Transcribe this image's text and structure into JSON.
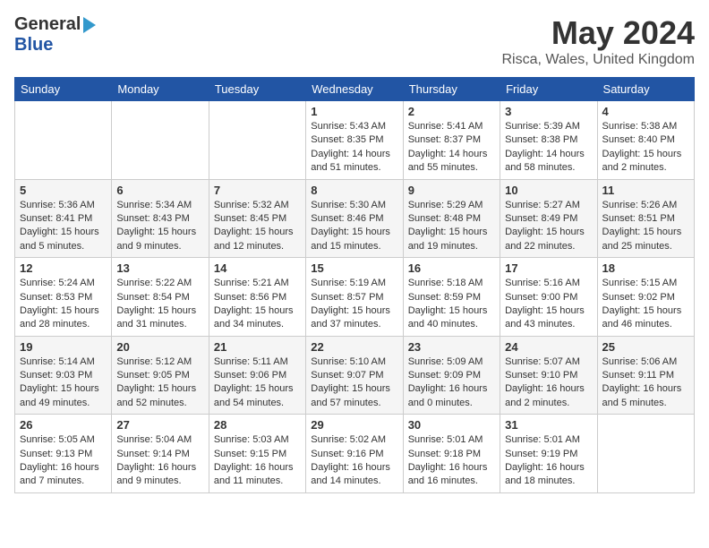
{
  "logo": {
    "general": "General",
    "blue": "Blue"
  },
  "title": {
    "month_year": "May 2024",
    "location": "Risca, Wales, United Kingdom"
  },
  "weekdays": [
    "Sunday",
    "Monday",
    "Tuesday",
    "Wednesday",
    "Thursday",
    "Friday",
    "Saturday"
  ],
  "weeks": [
    [
      {
        "day": "",
        "info": ""
      },
      {
        "day": "",
        "info": ""
      },
      {
        "day": "",
        "info": ""
      },
      {
        "day": "1",
        "info": "Sunrise: 5:43 AM\nSunset: 8:35 PM\nDaylight: 14 hours\nand 51 minutes."
      },
      {
        "day": "2",
        "info": "Sunrise: 5:41 AM\nSunset: 8:37 PM\nDaylight: 14 hours\nand 55 minutes."
      },
      {
        "day": "3",
        "info": "Sunrise: 5:39 AM\nSunset: 8:38 PM\nDaylight: 14 hours\nand 58 minutes."
      },
      {
        "day": "4",
        "info": "Sunrise: 5:38 AM\nSunset: 8:40 PM\nDaylight: 15 hours\nand 2 minutes."
      }
    ],
    [
      {
        "day": "5",
        "info": "Sunrise: 5:36 AM\nSunset: 8:41 PM\nDaylight: 15 hours\nand 5 minutes."
      },
      {
        "day": "6",
        "info": "Sunrise: 5:34 AM\nSunset: 8:43 PM\nDaylight: 15 hours\nand 9 minutes."
      },
      {
        "day": "7",
        "info": "Sunrise: 5:32 AM\nSunset: 8:45 PM\nDaylight: 15 hours\nand 12 minutes."
      },
      {
        "day": "8",
        "info": "Sunrise: 5:30 AM\nSunset: 8:46 PM\nDaylight: 15 hours\nand 15 minutes."
      },
      {
        "day": "9",
        "info": "Sunrise: 5:29 AM\nSunset: 8:48 PM\nDaylight: 15 hours\nand 19 minutes."
      },
      {
        "day": "10",
        "info": "Sunrise: 5:27 AM\nSunset: 8:49 PM\nDaylight: 15 hours\nand 22 minutes."
      },
      {
        "day": "11",
        "info": "Sunrise: 5:26 AM\nSunset: 8:51 PM\nDaylight: 15 hours\nand 25 minutes."
      }
    ],
    [
      {
        "day": "12",
        "info": "Sunrise: 5:24 AM\nSunset: 8:53 PM\nDaylight: 15 hours\nand 28 minutes."
      },
      {
        "day": "13",
        "info": "Sunrise: 5:22 AM\nSunset: 8:54 PM\nDaylight: 15 hours\nand 31 minutes."
      },
      {
        "day": "14",
        "info": "Sunrise: 5:21 AM\nSunset: 8:56 PM\nDaylight: 15 hours\nand 34 minutes."
      },
      {
        "day": "15",
        "info": "Sunrise: 5:19 AM\nSunset: 8:57 PM\nDaylight: 15 hours\nand 37 minutes."
      },
      {
        "day": "16",
        "info": "Sunrise: 5:18 AM\nSunset: 8:59 PM\nDaylight: 15 hours\nand 40 minutes."
      },
      {
        "day": "17",
        "info": "Sunrise: 5:16 AM\nSunset: 9:00 PM\nDaylight: 15 hours\nand 43 minutes."
      },
      {
        "day": "18",
        "info": "Sunrise: 5:15 AM\nSunset: 9:02 PM\nDaylight: 15 hours\nand 46 minutes."
      }
    ],
    [
      {
        "day": "19",
        "info": "Sunrise: 5:14 AM\nSunset: 9:03 PM\nDaylight: 15 hours\nand 49 minutes."
      },
      {
        "day": "20",
        "info": "Sunrise: 5:12 AM\nSunset: 9:05 PM\nDaylight: 15 hours\nand 52 minutes."
      },
      {
        "day": "21",
        "info": "Sunrise: 5:11 AM\nSunset: 9:06 PM\nDaylight: 15 hours\nand 54 minutes."
      },
      {
        "day": "22",
        "info": "Sunrise: 5:10 AM\nSunset: 9:07 PM\nDaylight: 15 hours\nand 57 minutes."
      },
      {
        "day": "23",
        "info": "Sunrise: 5:09 AM\nSunset: 9:09 PM\nDaylight: 16 hours\nand 0 minutes."
      },
      {
        "day": "24",
        "info": "Sunrise: 5:07 AM\nSunset: 9:10 PM\nDaylight: 16 hours\nand 2 minutes."
      },
      {
        "day": "25",
        "info": "Sunrise: 5:06 AM\nSunset: 9:11 PM\nDaylight: 16 hours\nand 5 minutes."
      }
    ],
    [
      {
        "day": "26",
        "info": "Sunrise: 5:05 AM\nSunset: 9:13 PM\nDaylight: 16 hours\nand 7 minutes."
      },
      {
        "day": "27",
        "info": "Sunrise: 5:04 AM\nSunset: 9:14 PM\nDaylight: 16 hours\nand 9 minutes."
      },
      {
        "day": "28",
        "info": "Sunrise: 5:03 AM\nSunset: 9:15 PM\nDaylight: 16 hours\nand 11 minutes."
      },
      {
        "day": "29",
        "info": "Sunrise: 5:02 AM\nSunset: 9:16 PM\nDaylight: 16 hours\nand 14 minutes."
      },
      {
        "day": "30",
        "info": "Sunrise: 5:01 AM\nSunset: 9:18 PM\nDaylight: 16 hours\nand 16 minutes."
      },
      {
        "day": "31",
        "info": "Sunrise: 5:01 AM\nSunset: 9:19 PM\nDaylight: 16 hours\nand 18 minutes."
      },
      {
        "day": "",
        "info": ""
      }
    ]
  ]
}
